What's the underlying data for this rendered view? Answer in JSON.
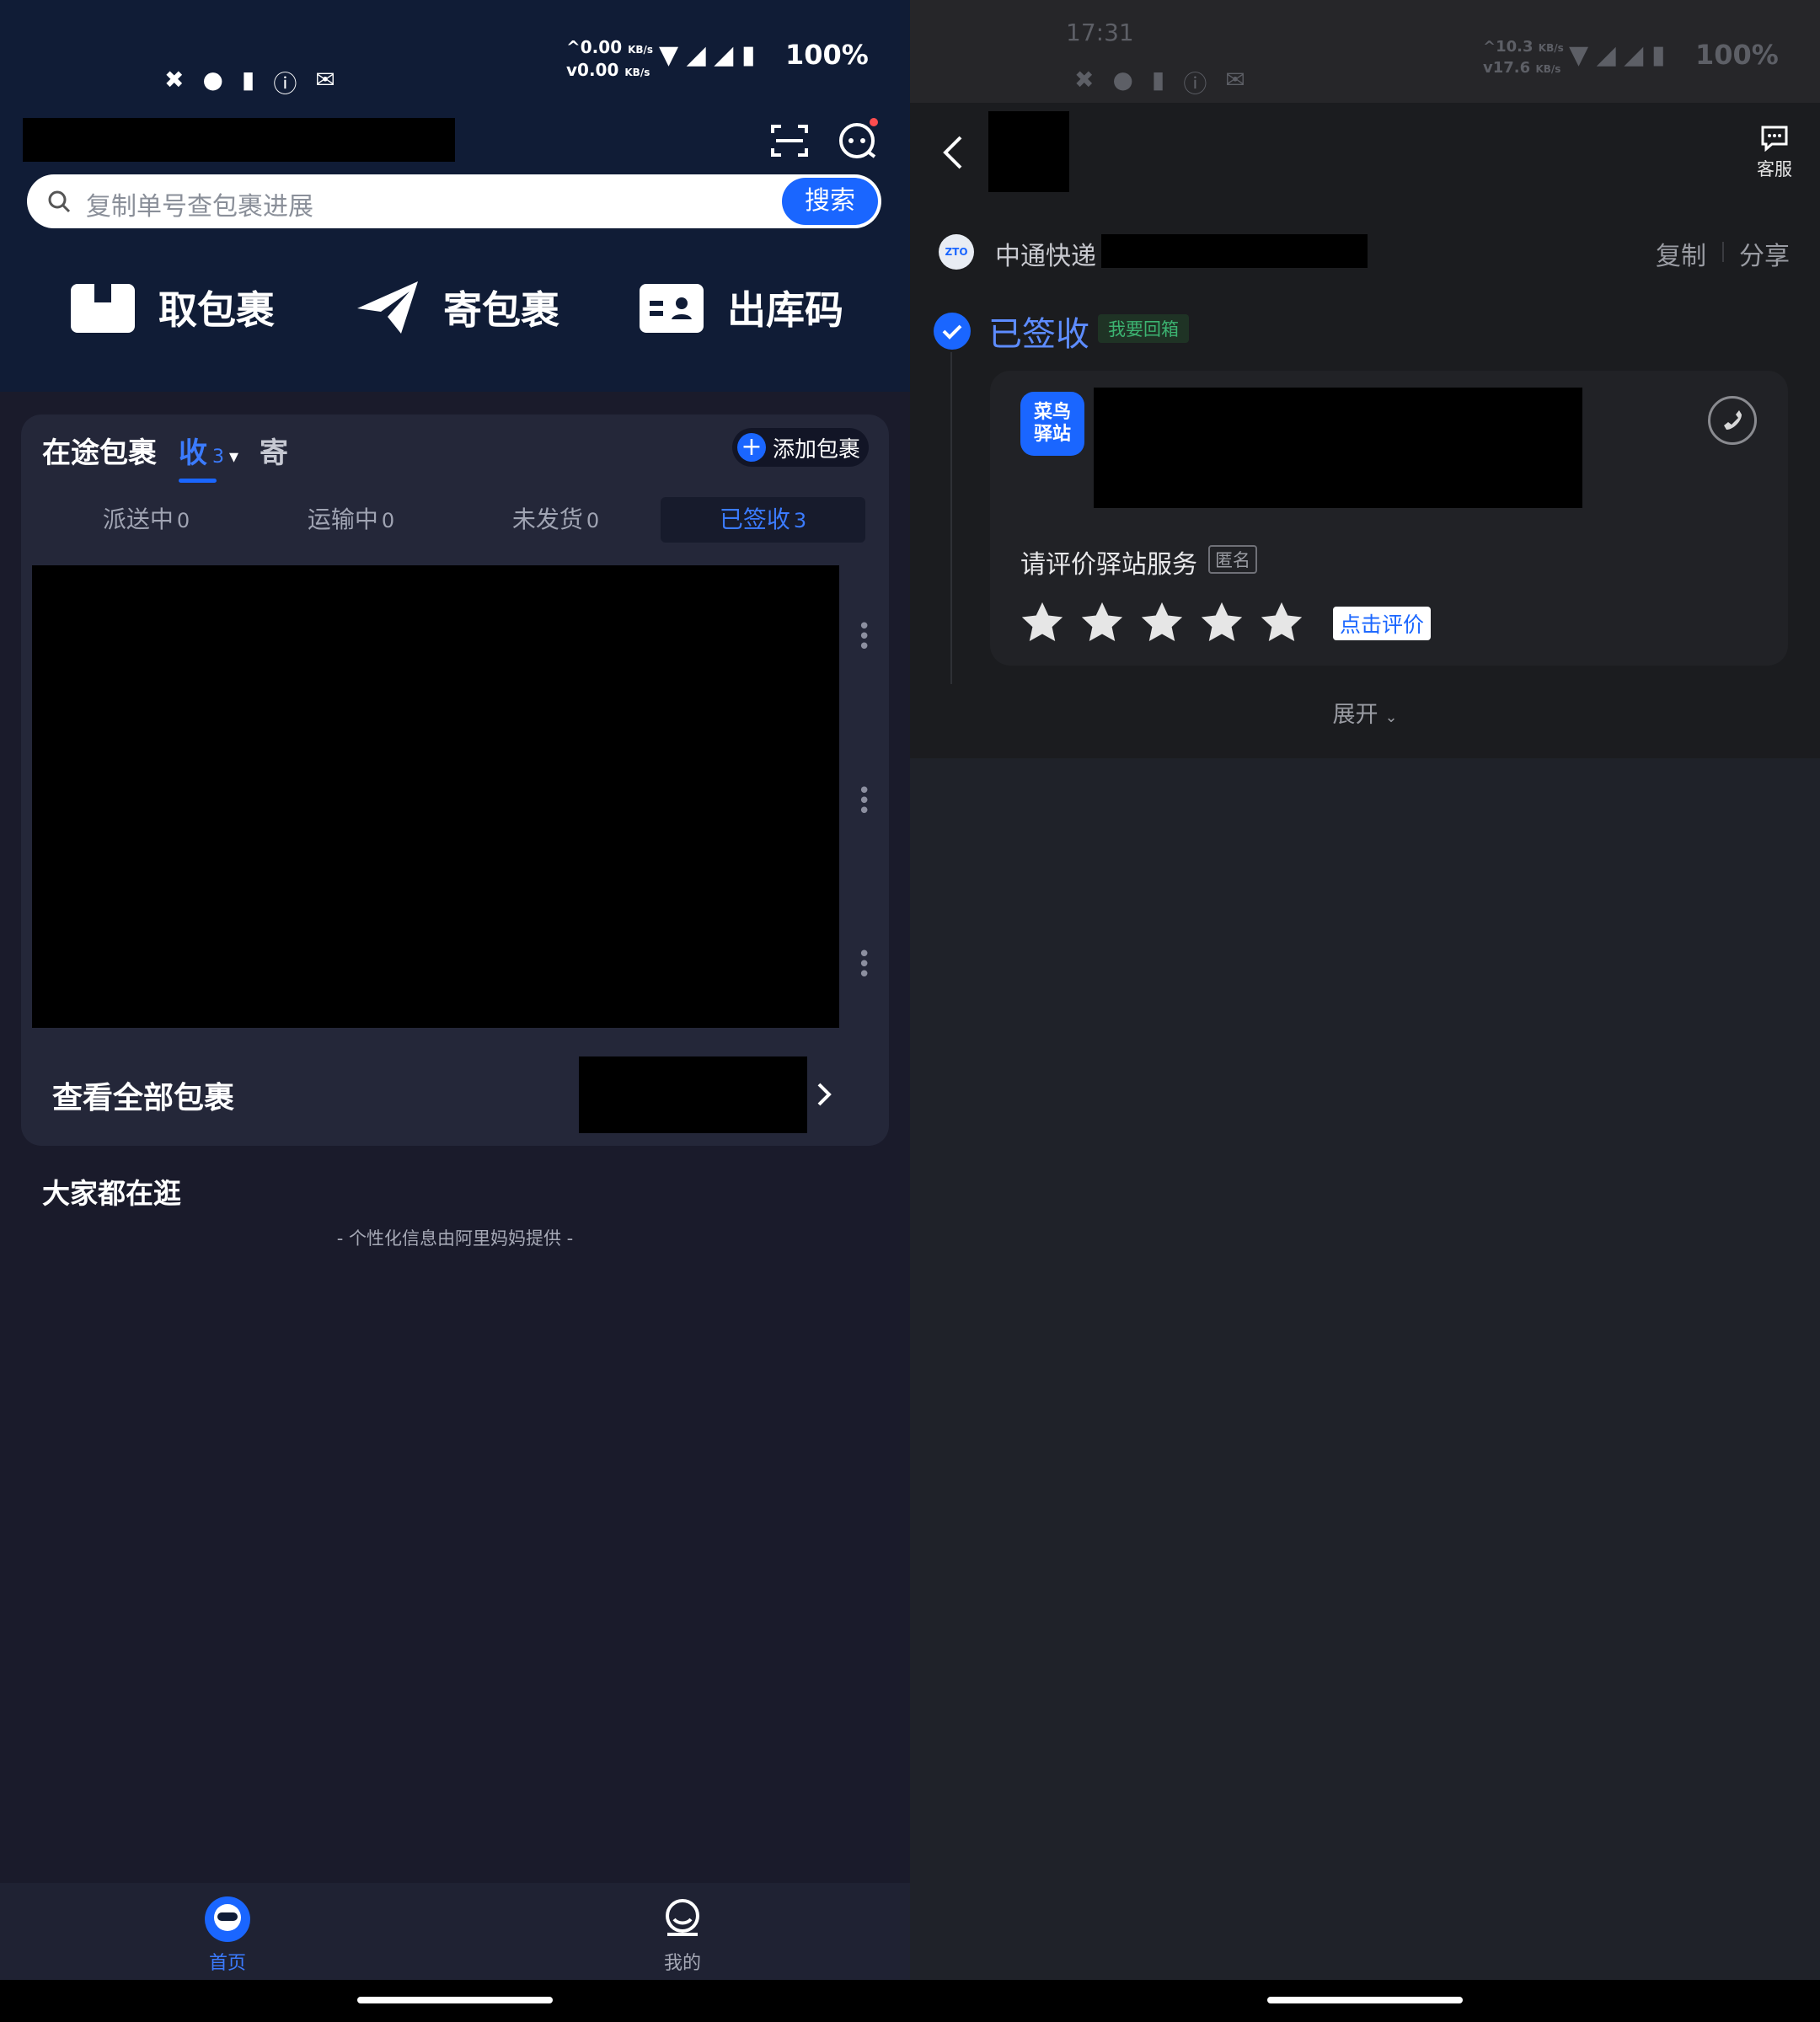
{
  "left": {
    "status": {
      "upload_speed": "0.00",
      "download_speed": "0.00",
      "speed_unit": "KB/s",
      "battery": "100%",
      "icons": [
        "notification-icon",
        "wechat-icon",
        "battery-alert-icon",
        "alert-icon",
        "mail-icon"
      ]
    },
    "search": {
      "placeholder": "复制单号查包裹进展",
      "button": "搜索"
    },
    "quick_actions": [
      {
        "label": "取包裹",
        "icon": "package-icon"
      },
      {
        "label": "寄包裹",
        "icon": "send-icon"
      },
      {
        "label": "出库码",
        "icon": "id-card-icon"
      }
    ],
    "packages": {
      "title": "在途包裹",
      "tab_receive": "收",
      "tab_receive_count": "3",
      "tab_send": "寄",
      "add_button": "添加包裹",
      "subtabs": [
        {
          "label": "派送中",
          "count": "0"
        },
        {
          "label": "运输中",
          "count": "0"
        },
        {
          "label": "未发货",
          "count": "0"
        },
        {
          "label": "已签收",
          "count": "3"
        }
      ],
      "view_all": "查看全部包裹"
    },
    "feed": {
      "title": "大家都在逛",
      "note": "- 个性化信息由阿里妈妈提供 -"
    },
    "nav": [
      {
        "label": "首页",
        "active": true
      },
      {
        "label": "我的",
        "active": false
      }
    ],
    "colors": {
      "accent": "#1a66ff",
      "header_bg": "#101c36",
      "card_bg": "#242739"
    }
  },
  "right": {
    "status": {
      "time": "17:31",
      "upload_speed": "10.3",
      "download_speed": "17.6",
      "speed_unit": "KB/s",
      "battery": "100%"
    },
    "header": {
      "service_label": "客服"
    },
    "courier": {
      "name": "中通快递",
      "copy": "复制",
      "share": "分享",
      "logo_text": "ZTO"
    },
    "status_block": {
      "title": "已签收",
      "tag": "我要回箱"
    },
    "station": {
      "logo_line1": "菜鸟",
      "logo_line2": "驿站",
      "rate_prompt": "请评价驿站服务",
      "anonymous": "匿名",
      "rate_button": "点击评价",
      "stars": 5
    },
    "expand": "展开",
    "colors": {
      "accent": "#1a66ff",
      "title_blue": "#5d8cff",
      "tag_green": "#3cb371"
    }
  }
}
